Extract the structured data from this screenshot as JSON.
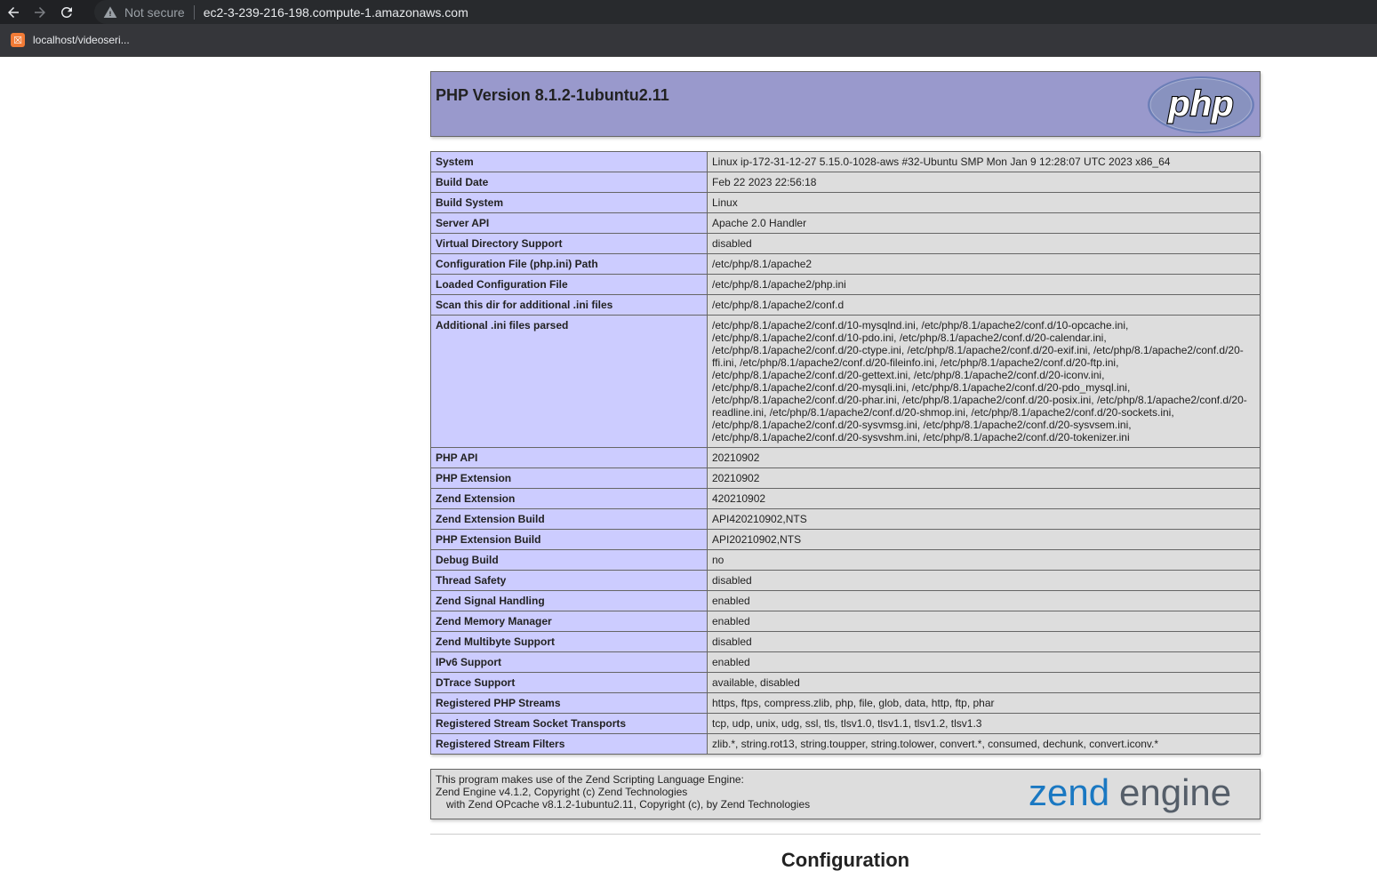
{
  "browser": {
    "security_label": "Not secure",
    "url": "ec2-3-239-216-198.compute-1.amazonaws.com",
    "bookmark_label": "localhost/videoseri..."
  },
  "php": {
    "version_title": "PHP Version 8.1.2-1ubuntu2.11",
    "logo_text": "php"
  },
  "info_rows": [
    {
      "key": "System",
      "value": "Linux ip-172-31-12-27 5.15.0-1028-aws #32-Ubuntu SMP Mon Jan 9 12:28:07 UTC 2023 x86_64"
    },
    {
      "key": "Build Date",
      "value": "Feb 22 2023 22:56:18"
    },
    {
      "key": "Build System",
      "value": "Linux"
    },
    {
      "key": "Server API",
      "value": "Apache 2.0 Handler"
    },
    {
      "key": "Virtual Directory Support",
      "value": "disabled"
    },
    {
      "key": "Configuration File (php.ini) Path",
      "value": "/etc/php/8.1/apache2"
    },
    {
      "key": "Loaded Configuration File",
      "value": "/etc/php/8.1/apache2/php.ini"
    },
    {
      "key": "Scan this dir for additional .ini files",
      "value": "/etc/php/8.1/apache2/conf.d"
    },
    {
      "key": "Additional .ini files parsed",
      "value": "/etc/php/8.1/apache2/conf.d/10-mysqlnd.ini, /etc/php/8.1/apache2/conf.d/10-opcache.ini, /etc/php/8.1/apache2/conf.d/10-pdo.ini, /etc/php/8.1/apache2/conf.d/20-calendar.ini, /etc/php/8.1/apache2/conf.d/20-ctype.ini, /etc/php/8.1/apache2/conf.d/20-exif.ini, /etc/php/8.1/apache2/conf.d/20-ffi.ini, /etc/php/8.1/apache2/conf.d/20-fileinfo.ini, /etc/php/8.1/apache2/conf.d/20-ftp.ini, /etc/php/8.1/apache2/conf.d/20-gettext.ini, /etc/php/8.1/apache2/conf.d/20-iconv.ini, /etc/php/8.1/apache2/conf.d/20-mysqli.ini, /etc/php/8.1/apache2/conf.d/20-pdo_mysql.ini, /etc/php/8.1/apache2/conf.d/20-phar.ini, /etc/php/8.1/apache2/conf.d/20-posix.ini, /etc/php/8.1/apache2/conf.d/20-readline.ini, /etc/php/8.1/apache2/conf.d/20-shmop.ini, /etc/php/8.1/apache2/conf.d/20-sockets.ini, /etc/php/8.1/apache2/conf.d/20-sysvmsg.ini, /etc/php/8.1/apache2/conf.d/20-sysvsem.ini, /etc/php/8.1/apache2/conf.d/20-sysvshm.ini, /etc/php/8.1/apache2/conf.d/20-tokenizer.ini"
    },
    {
      "key": "PHP API",
      "value": "20210902"
    },
    {
      "key": "PHP Extension",
      "value": "20210902"
    },
    {
      "key": "Zend Extension",
      "value": "420210902"
    },
    {
      "key": "Zend Extension Build",
      "value": "API420210902,NTS"
    },
    {
      "key": "PHP Extension Build",
      "value": "API20210902,NTS"
    },
    {
      "key": "Debug Build",
      "value": "no"
    },
    {
      "key": "Thread Safety",
      "value": "disabled"
    },
    {
      "key": "Zend Signal Handling",
      "value": "enabled"
    },
    {
      "key": "Zend Memory Manager",
      "value": "enabled"
    },
    {
      "key": "Zend Multibyte Support",
      "value": "disabled"
    },
    {
      "key": "IPv6 Support",
      "value": "enabled"
    },
    {
      "key": "DTrace Support",
      "value": "available, disabled"
    },
    {
      "key": "Registered PHP Streams",
      "value": "https, ftps, compress.zlib, php, file, glob, data, http, ftp, phar"
    },
    {
      "key": "Registered Stream Socket Transports",
      "value": "tcp, udp, unix, udg, ssl, tls, tlsv1.0, tlsv1.1, tlsv1.2, tlsv1.3"
    },
    {
      "key": "Registered Stream Filters",
      "value": "zlib.*, string.rot13, string.toupper, string.tolower, convert.*, consumed, dechunk, convert.iconv.*"
    }
  ],
  "zend": {
    "line1": "This program makes use of the Zend Scripting Language Engine:",
    "line2": "Zend Engine v4.1.2, Copyright (c) Zend Technologies",
    "line3": "with Zend OPcache v8.1.2-1ubuntu2.11, Copyright (c), by Zend Technologies",
    "logo_word1": "zend",
    "logo_word2": "engine"
  },
  "section_heading": "Configuration",
  "colors": {
    "header_bg": "#9999cc",
    "key_bg": "#ccccff",
    "value_bg": "#dddddd",
    "zend_blue": "#1a78c2",
    "zend_gray": "#555e69"
  }
}
